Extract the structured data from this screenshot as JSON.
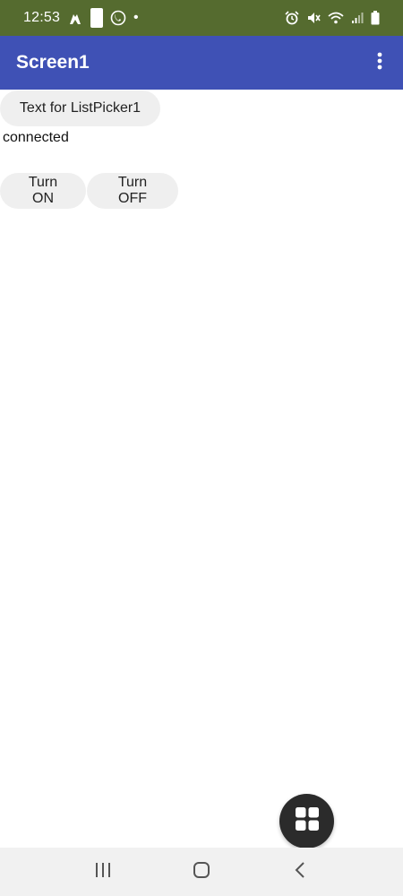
{
  "status_bar": {
    "time": "12:53",
    "dot": "•",
    "left_icons": [
      "hands-icon",
      "white-rectangle-icon",
      "phone-icon"
    ],
    "right_icons": [
      "alarm-icon",
      "mute-icon",
      "wifi-icon",
      "signal-icon",
      "battery-icon"
    ],
    "background": "#556b2f"
  },
  "app_bar": {
    "title": "Screen1",
    "background": "#3f51b5",
    "menu_icon": "more-vert-icon"
  },
  "main": {
    "listpicker_label": "Text for ListPicker1",
    "status_text": "connected",
    "turn_on_label": "Turn ON",
    "turn_off_label": "Turn OFF"
  },
  "fab": {
    "icon": "grid-icon",
    "background": "#2b2b2b"
  },
  "nav_bar": {
    "icons": [
      "recents-icon",
      "home-icon",
      "back-icon"
    ],
    "background": "#f1f1f1"
  }
}
